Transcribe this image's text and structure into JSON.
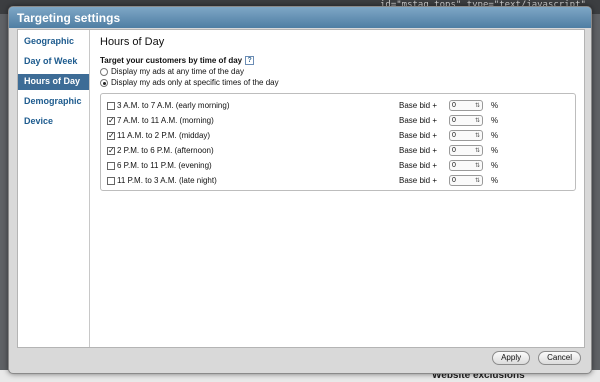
{
  "background": {
    "code_fragment": "id=\"mstag tops\" type=\"text/javascript\"",
    "footer_text": "Website exclusions"
  },
  "dialog": {
    "title": "Targeting settings",
    "sidebar": [
      "Geographic",
      "Day of Week",
      "Hours of Day",
      "Demographic",
      "Device"
    ],
    "active_index": 2,
    "section_title": "Hours of Day",
    "question": "Target your customers by time of day",
    "radios": [
      {
        "label": "Display my ads at any time of the day",
        "selected": false
      },
      {
        "label": "Display my ads only at specific times of the day",
        "selected": true
      }
    ],
    "schedule": [
      {
        "label": "3 A.M. to 7 A.M. (early morning)",
        "checked": false,
        "bid_label": "Base bid +",
        "bid": "0",
        "pct": "%"
      },
      {
        "label": "7 A.M. to 11 A.M. (morning)",
        "checked": true,
        "bid_label": "Base bid +",
        "bid": "0",
        "pct": "%"
      },
      {
        "label": "11 A.M. to 2 P.M. (midday)",
        "checked": true,
        "bid_label": "Base bid +",
        "bid": "0",
        "pct": "%"
      },
      {
        "label": "2 P.M. to 6 P.M. (afternoon)",
        "checked": true,
        "bid_label": "Base bid +",
        "bid": "0",
        "pct": "%"
      },
      {
        "label": "6 P.M. to 11 P.M. (evening)",
        "checked": false,
        "bid_label": "Base bid +",
        "bid": "0",
        "pct": "%"
      },
      {
        "label": "11 P.M. to 3 A.M. (late night)",
        "checked": false,
        "bid_label": "Base bid +",
        "bid": "0",
        "pct": "%"
      }
    ],
    "buttons": {
      "apply": "Apply",
      "cancel": "Cancel"
    }
  },
  "colors": {
    "accent": "#3d6c96",
    "title_bar": "#5f89ad",
    "link": "#1d5b8e"
  }
}
